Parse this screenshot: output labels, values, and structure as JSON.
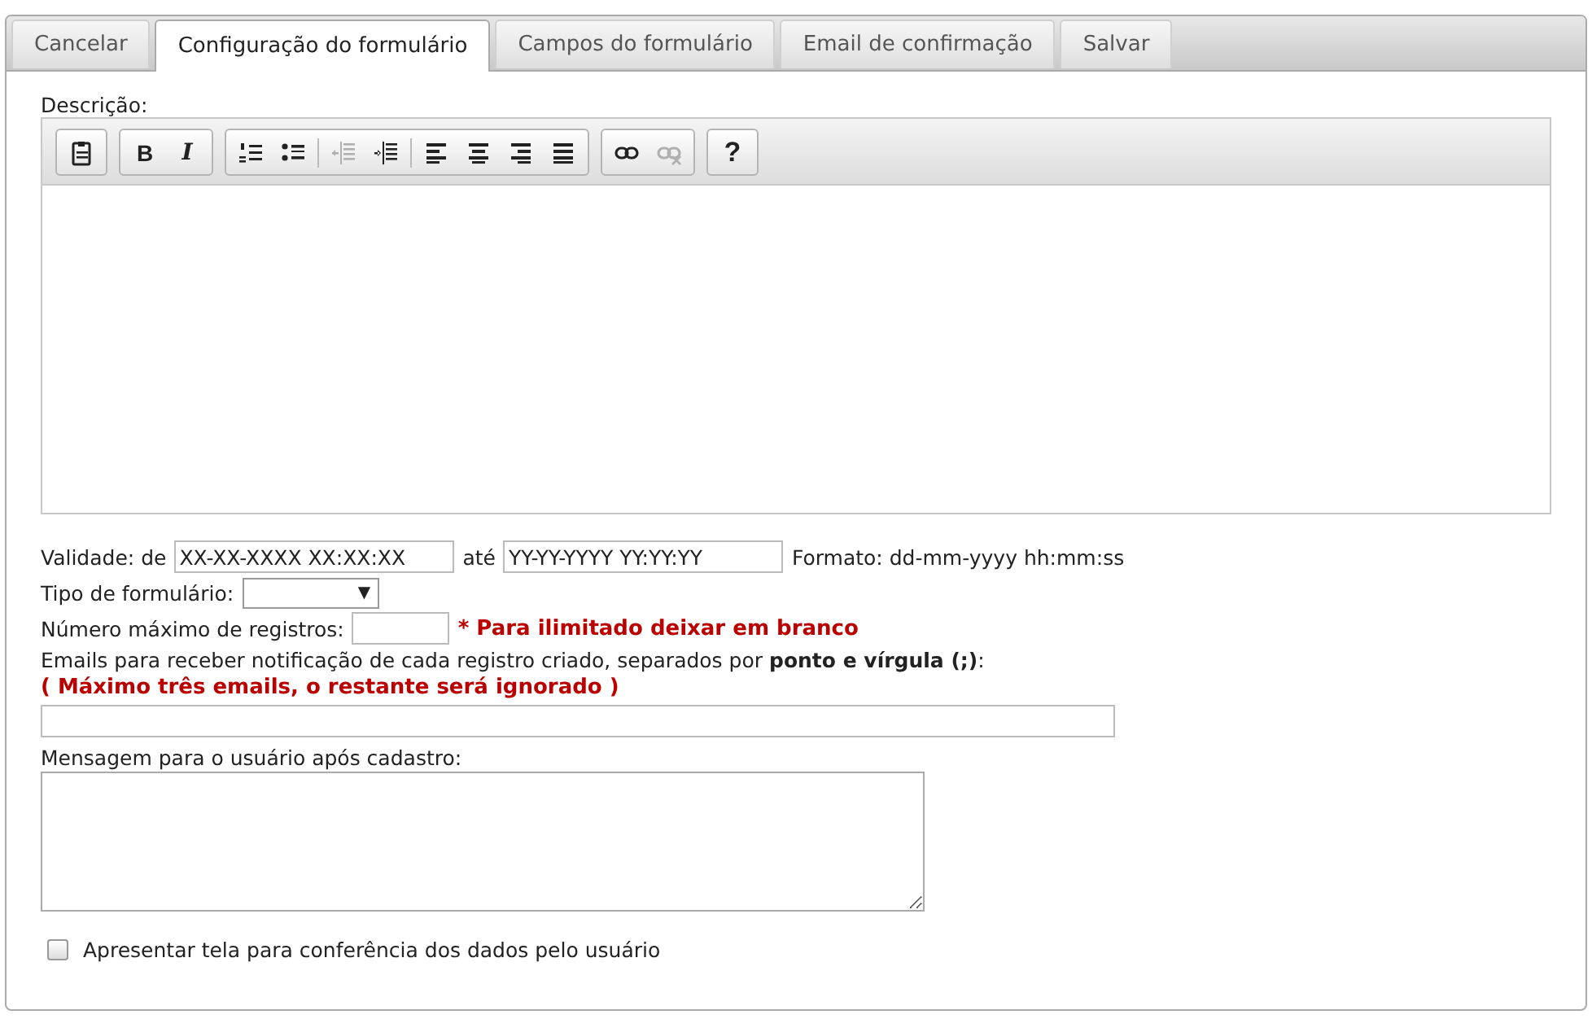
{
  "tabs": [
    {
      "label": "Cancelar",
      "selected": false
    },
    {
      "label": "Configuração do formulário",
      "selected": true
    },
    {
      "label": "Campos do formulário",
      "selected": false
    },
    {
      "label": "Email de confirmação",
      "selected": false
    },
    {
      "label": "Salvar",
      "selected": false
    }
  ],
  "description": {
    "label": "Descrição:",
    "toolbar": [
      [
        {
          "kind": "paste",
          "disabled": false
        }
      ],
      [
        {
          "kind": "bold",
          "label": "B",
          "disabled": false
        },
        {
          "kind": "italic",
          "label": "I",
          "disabled": false
        }
      ],
      [
        {
          "kind": "ordered-list",
          "disabled": false
        },
        {
          "kind": "bullet-list",
          "disabled": false
        },
        {
          "kind": "sep"
        },
        {
          "kind": "outdent",
          "disabled": true
        },
        {
          "kind": "indent",
          "disabled": false
        },
        {
          "kind": "sep"
        },
        {
          "kind": "align-left",
          "disabled": false
        },
        {
          "kind": "align-center",
          "disabled": false
        },
        {
          "kind": "align-right",
          "disabled": false
        },
        {
          "kind": "justify",
          "disabled": false
        }
      ],
      [
        {
          "kind": "link",
          "disabled": false
        },
        {
          "kind": "unlink",
          "disabled": true
        }
      ],
      [
        {
          "kind": "help",
          "label": "?",
          "disabled": false
        }
      ]
    ]
  },
  "validity": {
    "label": "Validade: de",
    "from": "XX-XX-XXXX XX:XX:XX",
    "until_label": "até",
    "until": "YY-YY-YYYY YY:YY:YY",
    "format": "Formato: dd-mm-yyyy hh:mm:ss"
  },
  "form_type": {
    "label": "Tipo de formulário:",
    "arrow": "▼"
  },
  "max_records": {
    "label": "Número máximo de registros:",
    "note": "* Para ilimitado deixar em branco"
  },
  "emails": {
    "label": "Emails para receber notificação de cada registro criado, separados por **ponto e vírgula (;)**:",
    "note": "( Máximo três emails, o restante será ignorado )"
  },
  "message": {
    "label": "Mensagem para o usuário após cadastro:"
  },
  "review": {
    "label": "Apresentar tela para conferência dos dados pelo usuário",
    "checked": false
  }
}
